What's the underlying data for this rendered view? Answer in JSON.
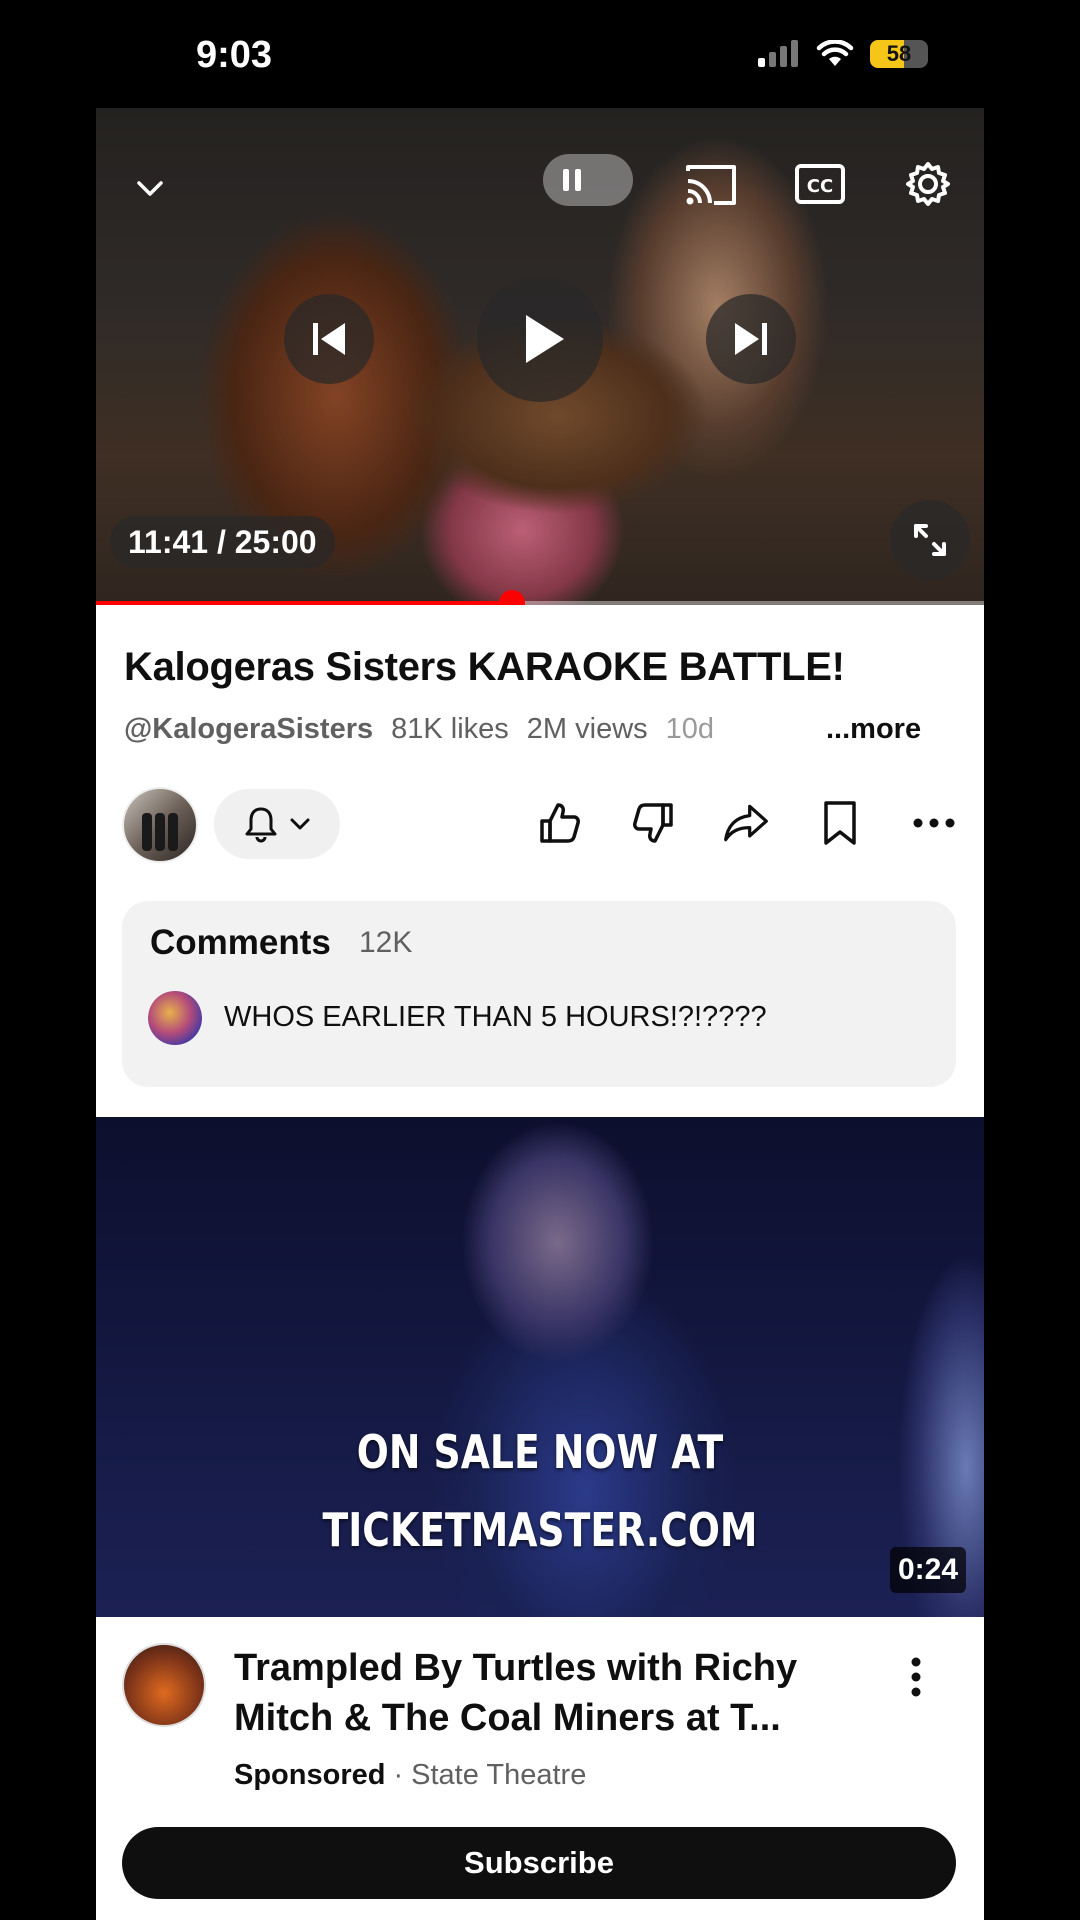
{
  "status_bar": {
    "time": "9:03",
    "battery_percent": "58"
  },
  "player": {
    "time_display": "11:41 / 25:00",
    "progress_fraction": 0.468
  },
  "video": {
    "title": "Kalogeras Sisters KARAOKE BATTLE!",
    "channel_handle": "@KalogeraSisters",
    "likes": "81K likes",
    "views": "2M views",
    "age": "10d",
    "more_label": "...more"
  },
  "comments": {
    "title": "Comments",
    "count": "12K",
    "top_comment": "WHOS EARLIER THAN 5 HOURS!?!????"
  },
  "ad": {
    "overlay_line1": "ON SALE NOW AT",
    "overlay_line2": "TICKETMASTER.COM",
    "duration": "0:24",
    "title": "Trampled By Turtles with Richy Mitch & The Coal Miners at T...",
    "sponsored_label": "Sponsored",
    "separator": "·",
    "channel": "State Theatre",
    "subscribe_label": "Subscribe"
  },
  "colors": {
    "accent": "#ff0000",
    "battery": "#f5c518",
    "text_primary": "#0f0f0f",
    "text_secondary": "#606060"
  },
  "icons": [
    "chevron-down-icon",
    "pause-icon",
    "cast-icon",
    "captions-icon",
    "settings-icon",
    "previous-icon",
    "play-icon",
    "next-icon",
    "fullscreen-icon",
    "bell-icon",
    "like-icon",
    "dislike-icon",
    "share-icon",
    "save-icon",
    "more-icon",
    "kebab-icon"
  ]
}
